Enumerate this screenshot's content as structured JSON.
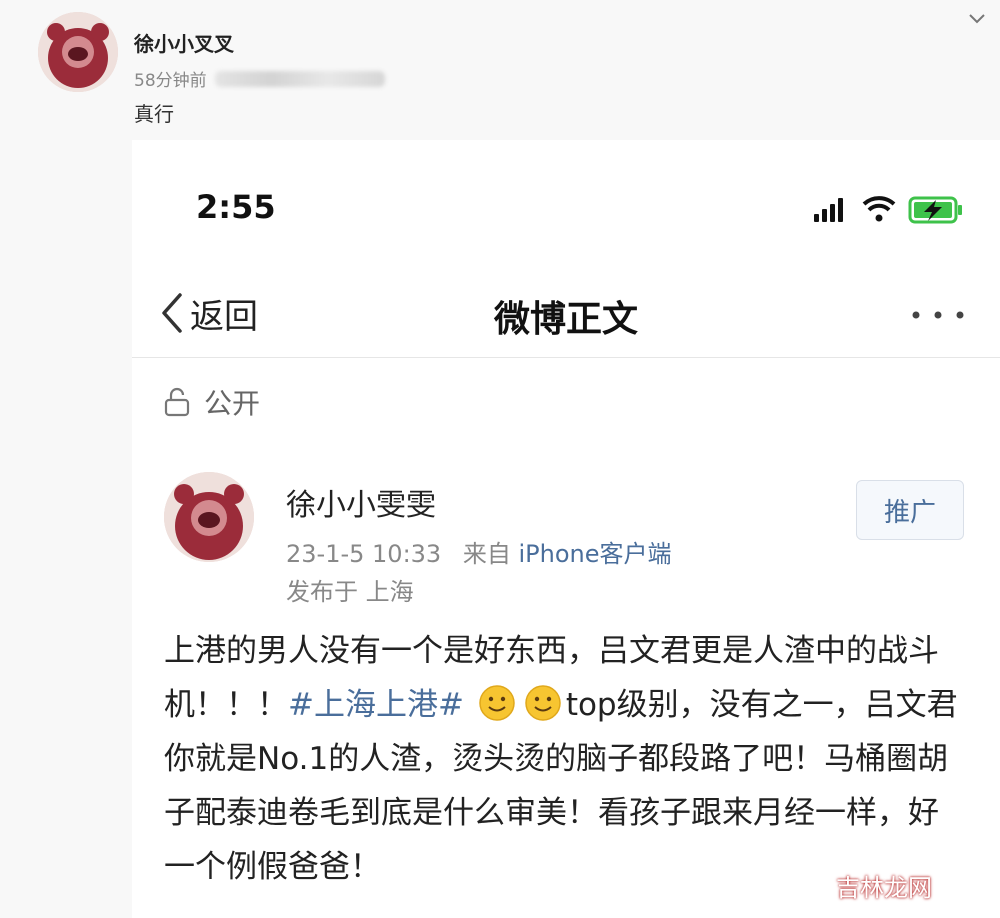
{
  "outer_post": {
    "author_name": "徐小小叉叉",
    "time": "58分钟前",
    "tag_text": "真行",
    "icons": {
      "avatar": "avatar",
      "menu": "chevron-down-icon",
      "redacted": "blurred-text"
    }
  },
  "status_bar": {
    "time": "2:55",
    "icons": [
      "signal-icon",
      "wifi-icon",
      "battery-charging-icon"
    ],
    "battery_color": "#3ec24a"
  },
  "nav_bar": {
    "back_label": "返回",
    "title": "微博正文",
    "more_icon": "more-icon"
  },
  "privacy": {
    "label": "公开",
    "icon": "unlock-icon"
  },
  "post": {
    "author_name": "徐小小雯雯",
    "date": "23-1-5 10:33",
    "source_prefix": "来自",
    "source_client": "iPhone客户端",
    "location": "发布于 上海",
    "promote_label": "推广",
    "body_part1": "上港的男人没有一个是好东西，吕文君更是人渣中的战斗机！！！",
    "hashtag": "#上海上港#",
    "body_part2": "top级别，没有之一，吕文君你就是No.1的人渣，烫头烫的脑子都段路了吧！马桶圈胡子配泰迪卷毛到底是什么审美！看孩子跟来月经一样，好一个例假爸爸！",
    "emoji_count": 2
  },
  "watermark": "吉林龙网",
  "colors": {
    "link": "#4a6e9b",
    "meta_gray": "#888888",
    "background": "#f8f8f8"
  }
}
